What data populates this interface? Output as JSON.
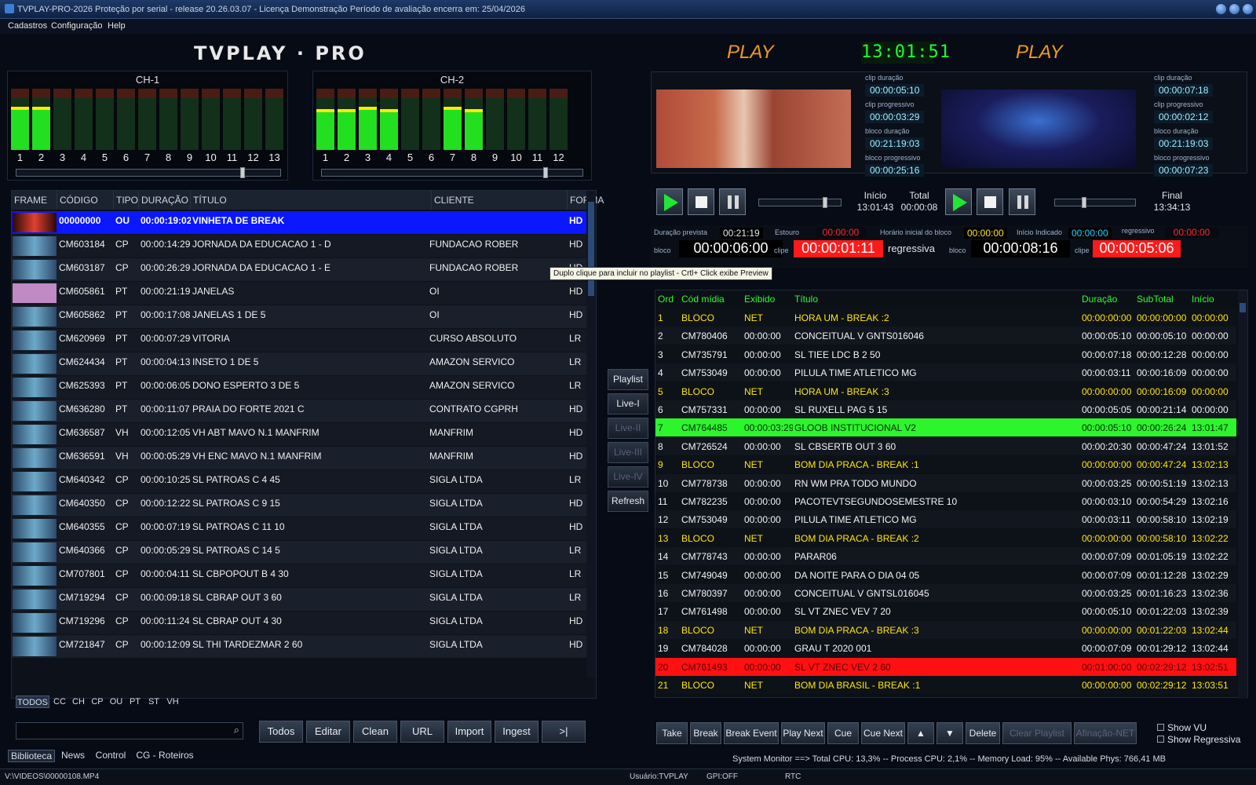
{
  "titlebar": {
    "title": "TVPLAY-PRO-2026  Proteção por serial     - release 20.26.03.07 - Licença  Demonstração  Período de avaliação encerra em: 25/04/2026"
  },
  "menu": [
    "Cadastros",
    "Configuração",
    "Help"
  ],
  "brand": "TVPLAY · PRO",
  "vu": {
    "ch1": {
      "title": "CH-1",
      "labels": [
        "1",
        "2",
        "3",
        "4",
        "5",
        "6",
        "7",
        "8",
        "9",
        "10",
        "11",
        "12",
        "13"
      ],
      "levels": [
        0.65,
        0.65,
        0,
        0,
        0,
        0,
        0,
        0,
        0,
        0,
        0,
        0,
        0
      ]
    },
    "ch2": {
      "title": "CH-2",
      "labels": [
        "1",
        "2",
        "3",
        "4",
        "5",
        "6",
        "7",
        "8",
        "9",
        "10",
        "11",
        "12"
      ],
      "levels": [
        0.62,
        0.62,
        0.65,
        0.62,
        0,
        0,
        0.65,
        0.62,
        0,
        0,
        0,
        0
      ]
    }
  },
  "player": {
    "play1": "PLAY",
    "play2": "PLAY",
    "clock": "13:01:51",
    "info1": [
      {
        "label": "clip duração",
        "value": "00:00:05:10"
      },
      {
        "label": "clip progressivo",
        "value": "00:00:03:29"
      },
      {
        "label": "bloco duração",
        "value": "00:21:19:03"
      },
      {
        "label": "bloco progressivo",
        "value": "00:00:25:16"
      }
    ],
    "info2": [
      {
        "label": "clip duração",
        "value": "00:00:07:18"
      },
      {
        "label": "clip progressivo",
        "value": "00:00:02:12"
      },
      {
        "label": "bloco duração",
        "value": "00:21:19:03"
      },
      {
        "label": "bloco progressivo",
        "value": "00:00:07:23"
      }
    ],
    "inicio_label": "Início",
    "inicio": "13:01:43",
    "total_label": "Total",
    "total": "00:00:08",
    "final_label": "Final",
    "final": "13:34:13",
    "slider1": 0.78,
    "slider2": 0.33
  },
  "timers": {
    "duracao_prevista_label": "Duração prevista",
    "duracao_prevista": "00:21:19",
    "estouro_label": "Estouro",
    "estouro": "00:00:00",
    "horario_inicial_label": "Horário inicial do bloco",
    "horario_inicial": "00:00:00",
    "inicio_indicado_label": "Início Indicado",
    "inicio_indicado": "00:00:00",
    "regressivo_label": "regressivo",
    "regressivo": "00:00:00",
    "bloco_label": "bloco",
    "clipe_label": "clipe",
    "bloco1": "00:00:06:00",
    "clipe1": "00:00:01:11",
    "regressiva": "regressiva",
    "bloco2": "00:00:08:16",
    "clipe2": "00:00:05:06"
  },
  "tooltip": "Duplo clique para incluir no playlist - Crtl+ Click exibe Preview",
  "library": {
    "headers": [
      "FRAME",
      "CÓDIGO",
      "TIPO",
      "DURAÇÃO",
      "TÍTULO",
      "CLIENTE",
      "FORMA"
    ],
    "rows": [
      {
        "cod": "00000000",
        "tipo": "OU",
        "dur": "00:00:19:02",
        "tit": "VINHETA DE BREAK",
        "cli": "",
        "fmt": "HD"
      },
      {
        "cod": "CM603184",
        "tipo": "CP",
        "dur": "00:00:14:29",
        "tit": "JORNADA DA EDUCACAO 1 - D",
        "cli": "FUNDACAO ROBER",
        "fmt": "HD"
      },
      {
        "cod": "CM603187",
        "tipo": "CP",
        "dur": "00:00:26:29",
        "tit": "JORNADA DA EDUCACAO 1 - E",
        "cli": "FUNDACAO ROBER",
        "fmt": "HD"
      },
      {
        "cod": "CM605861",
        "tipo": "PT",
        "dur": "00:00:21:19",
        "tit": "JANELAS",
        "cli": "OI",
        "fmt": "HD"
      },
      {
        "cod": "CM605862",
        "tipo": "PT",
        "dur": "00:00:17:08",
        "tit": "JANELAS 1 DE 5",
        "cli": "OI",
        "fmt": "HD"
      },
      {
        "cod": "CM620969",
        "tipo": "PT",
        "dur": "00:00:07:29",
        "tit": "VITORIA",
        "cli": "CURSO ABSOLUTO",
        "fmt": "LR"
      },
      {
        "cod": "CM624434",
        "tipo": "PT",
        "dur": "00:00:04:13",
        "tit": "INSETO 1 DE 5",
        "cli": "AMAZON SERVICO",
        "fmt": "LR"
      },
      {
        "cod": "CM625393",
        "tipo": "PT",
        "dur": "00:00:06:05",
        "tit": "DONO ESPERTO 3 DE 5",
        "cli": "AMAZON SERVICO",
        "fmt": "LR"
      },
      {
        "cod": "CM636280",
        "tipo": "PT",
        "dur": "00:00:11:07",
        "tit": "PRAIA DO FORTE 2021 C",
        "cli": "CONTRATO CGPRH",
        "fmt": "HD"
      },
      {
        "cod": "CM636587",
        "tipo": "VH",
        "dur": "00:00:12:05",
        "tit": "VH ABT MAVO N.1 MANFRIM",
        "cli": "MANFRIM",
        "fmt": "HD"
      },
      {
        "cod": "CM636591",
        "tipo": "VH",
        "dur": "00:00:05:29",
        "tit": "VH ENC MAVO N.1 MANFRIM",
        "cli": "MANFRIM",
        "fmt": "HD"
      },
      {
        "cod": "CM640342",
        "tipo": "CP",
        "dur": "00:00:10:25",
        "tit": "SL PATROAS C 4 45",
        "cli": "SIGLA LTDA",
        "fmt": "LR"
      },
      {
        "cod": "CM640350",
        "tipo": "CP",
        "dur": "00:00:12:22",
        "tit": "SL PATROAS C 9 15",
        "cli": "SIGLA LTDA",
        "fmt": "HD"
      },
      {
        "cod": "CM640355",
        "tipo": "CP",
        "dur": "00:00:07:19",
        "tit": "SL PATROAS C 11 10",
        "cli": "SIGLA LTDA",
        "fmt": "HD"
      },
      {
        "cod": "CM640366",
        "tipo": "CP",
        "dur": "00:00:05:29",
        "tit": "SL PATROAS C 14 5",
        "cli": "SIGLA LTDA",
        "fmt": "LR"
      },
      {
        "cod": "CM707801",
        "tipo": "CP",
        "dur": "00:00:04:11",
        "tit": "SL CBPOPOUT B 4 30",
        "cli": "SIGLA LTDA",
        "fmt": "LR"
      },
      {
        "cod": "CM719294",
        "tipo": "CP",
        "dur": "00:00:09:18",
        "tit": "SL CBRAP OUT 3 60",
        "cli": "SIGLA LTDA",
        "fmt": "LR"
      },
      {
        "cod": "CM719296",
        "tipo": "CP",
        "dur": "00:00:11:24",
        "tit": "SL CBRAP OUT 4 30",
        "cli": "SIGLA LTDA",
        "fmt": "HD"
      },
      {
        "cod": "CM721847",
        "tipo": "CP",
        "dur": "00:00:12:09",
        "tit": "SL THI TARDEZMAR 2 60",
        "cli": "SIGLA LTDA",
        "fmt": "HD"
      }
    ],
    "filters": [
      "TODOS",
      "CC",
      "CH",
      "CP",
      "OU",
      "PT",
      "ST",
      "VH"
    ],
    "buttons": [
      "Todos",
      "Editar",
      "Clean",
      "URL",
      "Import",
      "Ingest",
      ">|"
    ],
    "search_placeholder": "",
    "bottom_tabs": [
      "Biblioteca",
      "News",
      "Control",
      "CG - Roteiros"
    ]
  },
  "side_buttons": [
    "Playlist",
    "Live-I",
    "Live-II",
    "Live-III",
    "Live-IV",
    "Refresh"
  ],
  "playlist": {
    "headers": [
      "Ord",
      "Cód mídia",
      "Exibido",
      "Título",
      "Duração",
      "SubTotal",
      "Início"
    ],
    "rows": [
      {
        "ord": "1",
        "cod": "BLOCO",
        "exib": "NET",
        "tit": "HORA UM - BREAK :2",
        "dur": "00:00:00:00",
        "sub": "00:00:00:00",
        "ini": "00:00:00",
        "k": "blk"
      },
      {
        "ord": "2",
        "cod": "CM780406",
        "exib": "00:00:00",
        "tit": "CONCEITUAL V GNTS016046",
        "dur": "00:00:05:10",
        "sub": "00:00:05:10",
        "ini": "00:00:00",
        "k": ""
      },
      {
        "ord": "3",
        "cod": "CM735791",
        "exib": "00:00:00",
        "tit": "SL TIEE LDC B 2 50",
        "dur": "00:00:07:18",
        "sub": "00:00:12:28",
        "ini": "00:00:00",
        "k": ""
      },
      {
        "ord": "4",
        "cod": "CM753049",
        "exib": "00:00:00",
        "tit": "PILULA TIME ATLETICO MG",
        "dur": "00:00:03:11",
        "sub": "00:00:16:09",
        "ini": "00:00:00",
        "k": ""
      },
      {
        "ord": "5",
        "cod": "BLOCO",
        "exib": "NET",
        "tit": "HORA UM - BREAK :3",
        "dur": "00:00:00:00",
        "sub": "00:00:16:09",
        "ini": "00:00:00",
        "k": "blk"
      },
      {
        "ord": "6",
        "cod": "CM757331",
        "exib": "00:00:00",
        "tit": "SL RUXELL PAG 5 15",
        "dur": "00:00:05:05",
        "sub": "00:00:21:14",
        "ini": "00:00:00",
        "k": ""
      },
      {
        "ord": "7",
        "cod": "CM764485",
        "exib": "00:00:03:29",
        "tit": "GLOOB INSTITUCIONAL V2",
        "dur": "00:00:05:10",
        "sub": "00:00:26:24",
        "ini": "13:01:47",
        "k": "cur"
      },
      {
        "ord": "8",
        "cod": "CM726524",
        "exib": "00:00:00",
        "tit": "SL CBSERTB OUT 3 60",
        "dur": "00:00:20:30",
        "sub": "00:00:47:24",
        "ini": "13:01:52",
        "k": ""
      },
      {
        "ord": "9",
        "cod": "BLOCO",
        "exib": "NET",
        "tit": "BOM DIA PRACA - BREAK :1",
        "dur": "00:00:00:00",
        "sub": "00:00:47:24",
        "ini": "13:02:13",
        "k": "blk"
      },
      {
        "ord": "10",
        "cod": "CM778738",
        "exib": "00:00:00",
        "tit": "RN WM PRA TODO MUNDO",
        "dur": "00:00:03:25",
        "sub": "00:00:51:19",
        "ini": "13:02:13",
        "k": ""
      },
      {
        "ord": "11",
        "cod": "CM782235",
        "exib": "00:00:00",
        "tit": "PACOTEVTSEGUNDOSEMESTRE 10",
        "dur": "00:00:03:10",
        "sub": "00:00:54:29",
        "ini": "13:02:16",
        "k": ""
      },
      {
        "ord": "12",
        "cod": "CM753049",
        "exib": "00:00:00",
        "tit": "PILULA TIME ATLETICO MG",
        "dur": "00:00:03:11",
        "sub": "00:00:58:10",
        "ini": "13:02:19",
        "k": ""
      },
      {
        "ord": "13",
        "cod": "BLOCO",
        "exib": "NET",
        "tit": "BOM DIA PRACA - BREAK :2",
        "dur": "00:00:00:00",
        "sub": "00:00:58:10",
        "ini": "13:02:22",
        "k": "blk"
      },
      {
        "ord": "14",
        "cod": "CM778743",
        "exib": "00:00:00",
        "tit": "PARAR06",
        "dur": "00:00:07:09",
        "sub": "00:01:05:19",
        "ini": "13:02:22",
        "k": ""
      },
      {
        "ord": "15",
        "cod": "CM749049",
        "exib": "00:00:00",
        "tit": "DA NOITE PARA O DIA 04 05",
        "dur": "00:00:07:09",
        "sub": "00:01:12:28",
        "ini": "13:02:29",
        "k": ""
      },
      {
        "ord": "16",
        "cod": "CM780397",
        "exib": "00:00:00",
        "tit": "CONCEITUAL V GNTSL016045",
        "dur": "00:00:03:25",
        "sub": "00:01:16:23",
        "ini": "13:02:36",
        "k": ""
      },
      {
        "ord": "17",
        "cod": "CM761498",
        "exib": "00:00:00",
        "tit": "SL VT ZNEC VEV 7 20",
        "dur": "00:00:05:10",
        "sub": "00:01:22:03",
        "ini": "13:02:39",
        "k": ""
      },
      {
        "ord": "18",
        "cod": "BLOCO",
        "exib": "NET",
        "tit": "BOM DIA PRACA - BREAK :3",
        "dur": "00:00:00:00",
        "sub": "00:01:22:03",
        "ini": "13:02:44",
        "k": "blk"
      },
      {
        "ord": "19",
        "cod": "CM784028",
        "exib": "00:00:00",
        "tit": "GRAU T 2020 001",
        "dur": "00:00:07:09",
        "sub": "00:01:29:12",
        "ini": "13:02:44",
        "k": ""
      },
      {
        "ord": "20",
        "cod": "CM761493",
        "exib": "00:00:00",
        "tit": "SL VT ZNEC VEV 2 60",
        "dur": "00:01:00:00",
        "sub": "00:02:29:12",
        "ini": "13:02:51",
        "k": "err"
      },
      {
        "ord": "21",
        "cod": "BLOCO",
        "exib": "NET",
        "tit": "BOM DIA BRASIL - BREAK :1",
        "dur": "00:00:00:00",
        "sub": "00:02:29:12",
        "ini": "13:03:51",
        "k": "blk"
      }
    ],
    "buttons": [
      "Take",
      "Break",
      "Break Event",
      "Play Next",
      "Cue",
      "Cue Next",
      "▲",
      "▼",
      "Delete",
      "Clear Playlist",
      "Afinação-NET"
    ],
    "show_vu": "Show VU",
    "show_reg": "Show Regressiva"
  },
  "monitor": "System Monitor ==> Total CPU: 13,3% -- Process CPU: 2,1% -- Memory Load: 95% -- Available Phys: 766,41 MB",
  "status": {
    "path": "V:\\VIDEOS\\00000108.MP4",
    "user": "Usuário:TVPLAY",
    "gpi": "GPI:OFF",
    "rtc": "RTC"
  }
}
